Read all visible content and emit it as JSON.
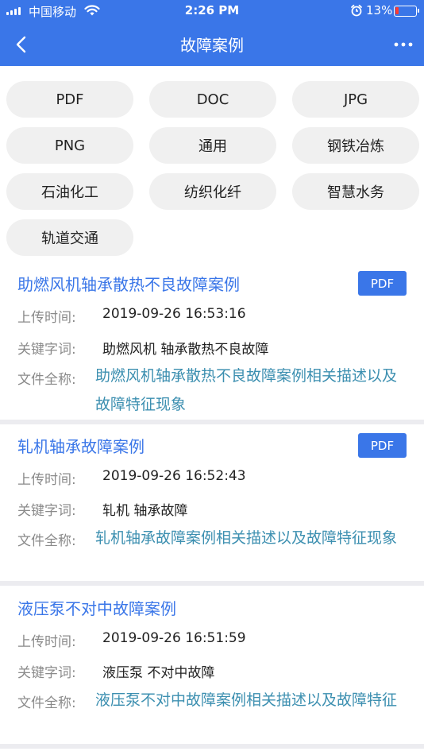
{
  "status": {
    "carrier": "中国移动",
    "time": "2:26 PM",
    "battery": "13%",
    "icons": [
      "signal-icon",
      "wifi-icon",
      "alarm-icon",
      "battery-icon"
    ]
  },
  "nav": {
    "title": "故障案例",
    "back_icon": "chevron-left-icon",
    "more_icon": "more-icon"
  },
  "tags": [
    "PDF",
    "DOC",
    "JPG",
    "PNG",
    "通用",
    "钢铁冶炼",
    "石油化工",
    "纺织化纤",
    "智慧水务",
    "轨道交通"
  ],
  "labels": {
    "upload_time": "上传时间:",
    "keywords": "关键字词:",
    "full_name": "文件全称:"
  },
  "cases": [
    {
      "title": "助燃风机轴承散热不良故障案例",
      "type": "PDF",
      "upload_time": "2019-09-26 16:53:16",
      "keywords": "助燃风机 轴承散热不良故障",
      "full_name": "助燃风机轴承散热不良故障案例相关描述以及故障特征现象"
    },
    {
      "title": "轧机轴承故障案例",
      "type": "PDF",
      "upload_time": "2019-09-26 16:52:43",
      "keywords": "轧机 轴承故障",
      "full_name": "轧机轴承故障案例相关描述以及故障特征现象"
    },
    {
      "title": "液压泵不对中故障案例",
      "type": "",
      "upload_time": "2019-09-26 16:51:59",
      "keywords": "液压泵 不对中故障",
      "full_name": "液压泵不对中故障案例相关描述以及故障特征"
    }
  ],
  "colors": {
    "primary": "#3a76e8",
    "link": "#3c8fb0",
    "tag_bg": "#f0f0f0",
    "label": "#8a8a8a",
    "battery_low": "#ff3b30"
  }
}
